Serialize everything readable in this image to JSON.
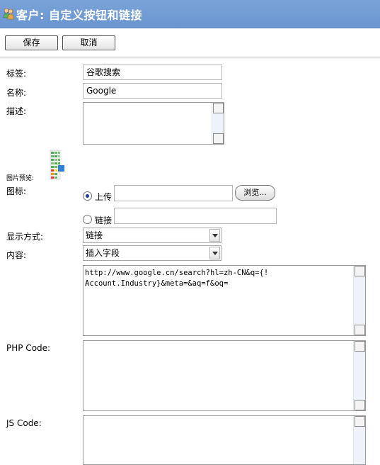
{
  "header": {
    "title": "客户: 自定义按钮和链接"
  },
  "toolbar": {
    "save_label": "保存",
    "cancel_label": "取消"
  },
  "form": {
    "label_label": "标签:",
    "label_value": "谷歌搜索",
    "name_label": "名称:",
    "name_value": "Google",
    "desc_label": "描述:",
    "desc_value": "",
    "image_preview_label": "图片预览:",
    "icon_label": "图标:",
    "upload_label": "上传",
    "browse_label": "浏览...",
    "link_label": "链接",
    "link_value": "",
    "display_label": "显示方式:",
    "display_value": "链接",
    "content_label": "内容:",
    "content_select_value": "插入字段",
    "content_text": "http://www.google.cn/search?hl=zh-CN&q={!\nAccount.Industry}&meta=&aq=f&oq=",
    "php_label": "PHP Code:",
    "php_value": "",
    "js_label": "JS Code:",
    "js_value": ""
  },
  "icons": {
    "title": "user-group-icon",
    "preview": "image-preview-icon"
  },
  "colors": {
    "titlebar": "#6a95cf",
    "title_text": "#ffffff",
    "scroll_track": "#eef3fa"
  }
}
